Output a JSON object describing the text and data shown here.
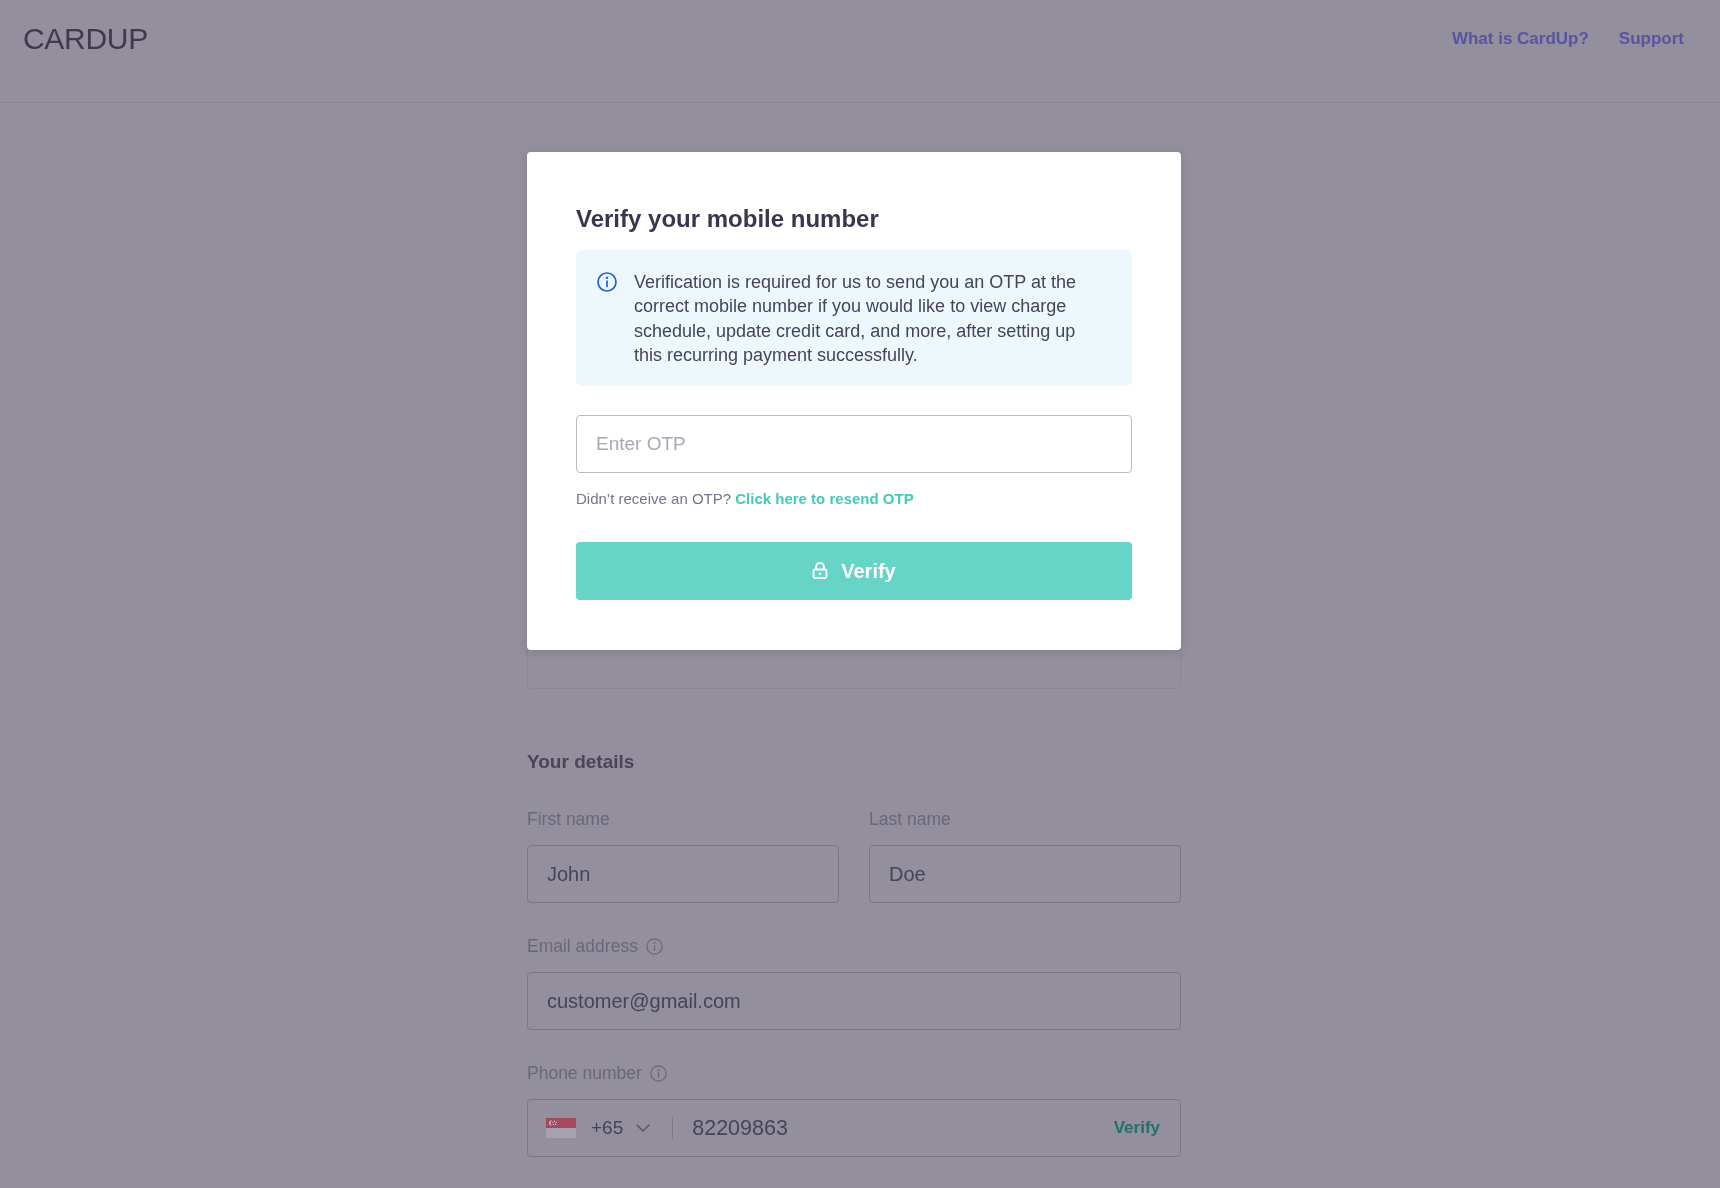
{
  "header": {
    "logo": "CARDUP",
    "links": [
      "What is CardUp?",
      "Support"
    ]
  },
  "your_details": {
    "title": "Your details",
    "fields": [
      {
        "kind": "name",
        "label": "First name",
        "value": "John"
      },
      {
        "kind": "name",
        "label": "Last name",
        "value": "Doe"
      },
      {
        "kind": "email",
        "label": "Email address",
        "value": "customer@gmail.com"
      },
      {
        "kind": "phone",
        "label": "Phone number",
        "country_code": "+65",
        "value": "82209863",
        "action": "Verify"
      }
    ]
  },
  "modal": {
    "title": "Verify your mobile number",
    "notice": "Verification is required for us to send you an OTP at the correct mobile number if you would like to view charge schedule, update credit card, and more, after setting up this recurring payment successfully.",
    "otp_field": {
      "placeholder": "Enter OTP"
    },
    "resend_prompt": "Didn’t receive an OTP?",
    "resend_link": "Click here to resend OTP",
    "submit_button": "Verify"
  }
}
